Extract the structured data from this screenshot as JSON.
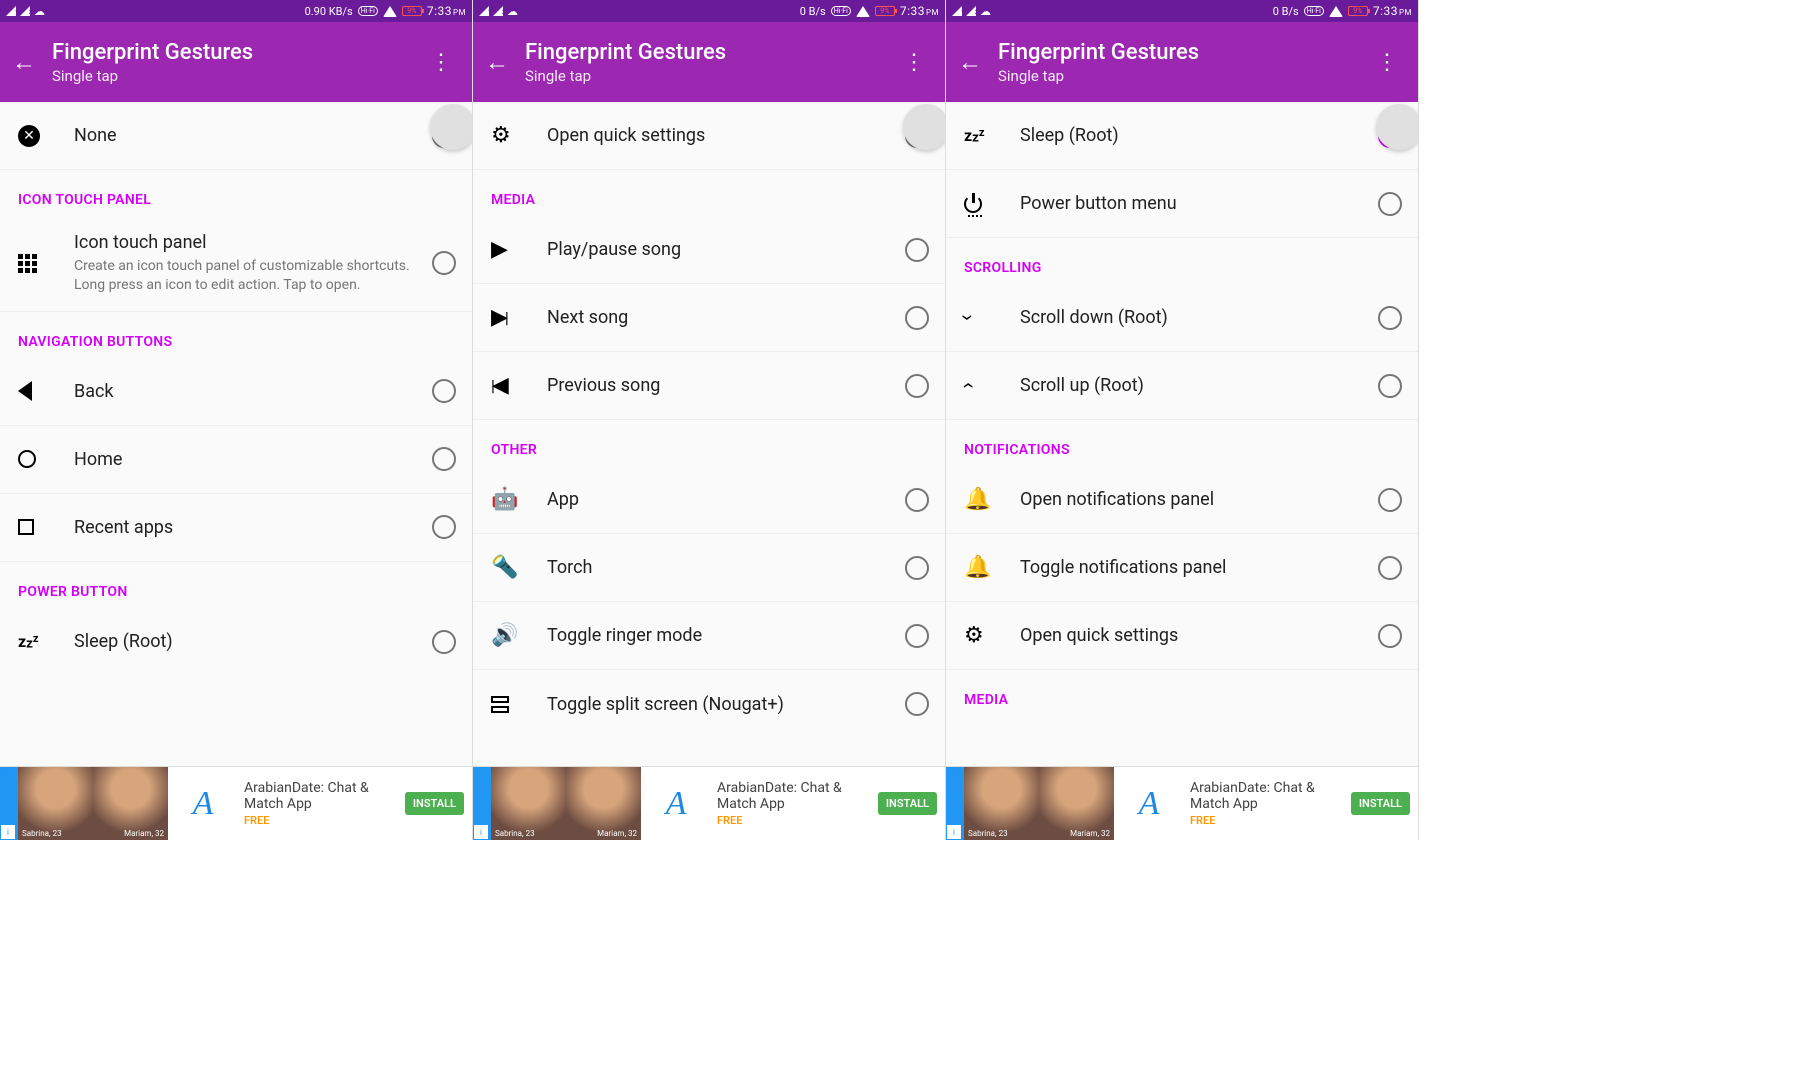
{
  "statusbar": {
    "left": {
      "net1": "1",
      "net2": "2",
      "cloud": "☁"
    },
    "speed_a": "0.90 KB/s",
    "speed_b": "0 B/s",
    "speed_c": "0 B/s",
    "battery": "9%",
    "time": "7:33",
    "pm": "PM"
  },
  "appbar": {
    "title": "Fingerprint Gestures",
    "subtitle": "Single tap"
  },
  "s1": {
    "none": "None",
    "sec_icon_panel": "ICON TOUCH PANEL",
    "icon_panel_title": "Icon touch panel",
    "icon_panel_desc": "Create an icon touch panel of customizable shortcuts. Long press an icon to edit action. Tap to open.",
    "sec_nav": "NAVIGATION BUTTONS",
    "back": "Back",
    "home": "Home",
    "recent": "Recent apps",
    "sec_power": "POWER BUTTON",
    "sleep": "Sleep (Root)"
  },
  "s2": {
    "quick": "Open quick settings",
    "sec_media": "MEDIA",
    "play": "Play/pause song",
    "next": "Next song",
    "prev": "Previous song",
    "sec_other": "OTHER",
    "app": "App",
    "torch": "Torch",
    "ringer": "Toggle ringer mode",
    "split": "Toggle split screen (Nougat+)"
  },
  "s3": {
    "sleep": "Sleep (Root)",
    "power_menu": "Power button menu",
    "sec_scroll": "SCROLLING",
    "scroll_down": "Scroll down (Root)",
    "scroll_up": "Scroll up (Root)",
    "sec_notif": "NOTIFICATIONS",
    "open_notif": "Open notifications panel",
    "toggle_notif": "Toggle notifications panel",
    "quick": "Open quick settings",
    "sec_media": "MEDIA"
  },
  "ad": {
    "title": "ArabianDate: Chat & Match App",
    "free": "FREE",
    "install": "INSTALL",
    "name1": "Sabrina, 23",
    "name2": "Mariam, 32"
  }
}
